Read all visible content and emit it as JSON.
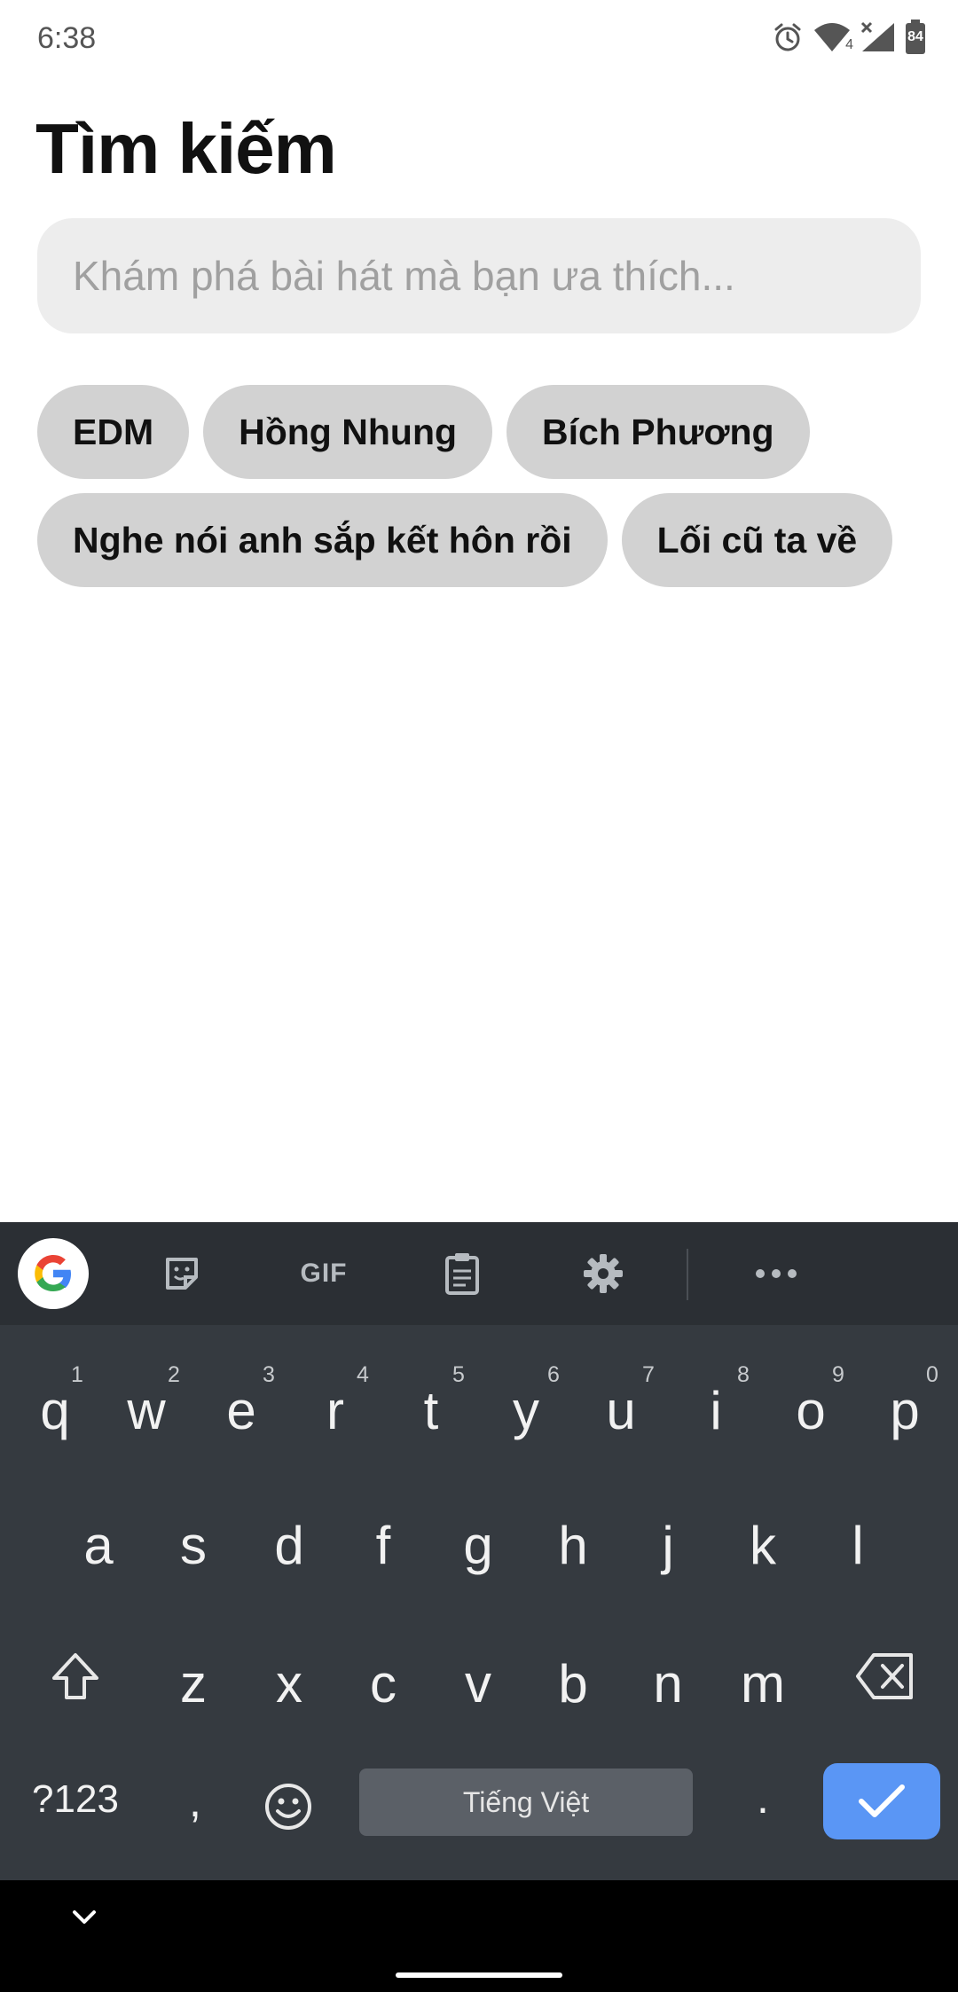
{
  "status_bar": {
    "time": "6:38",
    "icons": [
      "alarm-icon",
      "wifi-icon",
      "signal-icon",
      "battery-icon"
    ],
    "network_badge": "4",
    "battery_level": "84"
  },
  "page": {
    "title": "Tìm kiếm",
    "search": {
      "placeholder": "Khám phá bài hát mà bạn ưa thích...",
      "value": ""
    },
    "suggestions": [
      {
        "label": "EDM"
      },
      {
        "label": "Hồng Nhung"
      },
      {
        "label": "Bích Phương"
      },
      {
        "label": "Nghe nói anh sắp kết hôn rồi"
      },
      {
        "label": "Lối cũ ta về"
      }
    ]
  },
  "keyboard": {
    "toolbar": {
      "items": [
        "google-icon",
        "sticker-icon",
        "gif-button",
        "clipboard-icon",
        "settings-icon",
        "more-icon"
      ],
      "gif_label": "GIF"
    },
    "row1": [
      {
        "key": "q",
        "hint": "1"
      },
      {
        "key": "w",
        "hint": "2"
      },
      {
        "key": "e",
        "hint": "3"
      },
      {
        "key": "r",
        "hint": "4"
      },
      {
        "key": "t",
        "hint": "5"
      },
      {
        "key": "y",
        "hint": "6"
      },
      {
        "key": "u",
        "hint": "7"
      },
      {
        "key": "i",
        "hint": "8"
      },
      {
        "key": "o",
        "hint": "9"
      },
      {
        "key": "p",
        "hint": "0"
      }
    ],
    "row2": [
      "a",
      "s",
      "d",
      "f",
      "g",
      "h",
      "j",
      "k",
      "l"
    ],
    "row3": [
      "z",
      "x",
      "c",
      "v",
      "b",
      "n",
      "m"
    ],
    "symbols_label": "?123",
    "comma_label": ",",
    "space_label": "Tiếng Việt",
    "period_label": ".",
    "colors": {
      "background": "#353a40",
      "toolbar": "#2b2f34",
      "enter": "#5a96f5"
    }
  },
  "nav_bar": {
    "icons": [
      "chevron-down-icon",
      "home-handle"
    ]
  }
}
